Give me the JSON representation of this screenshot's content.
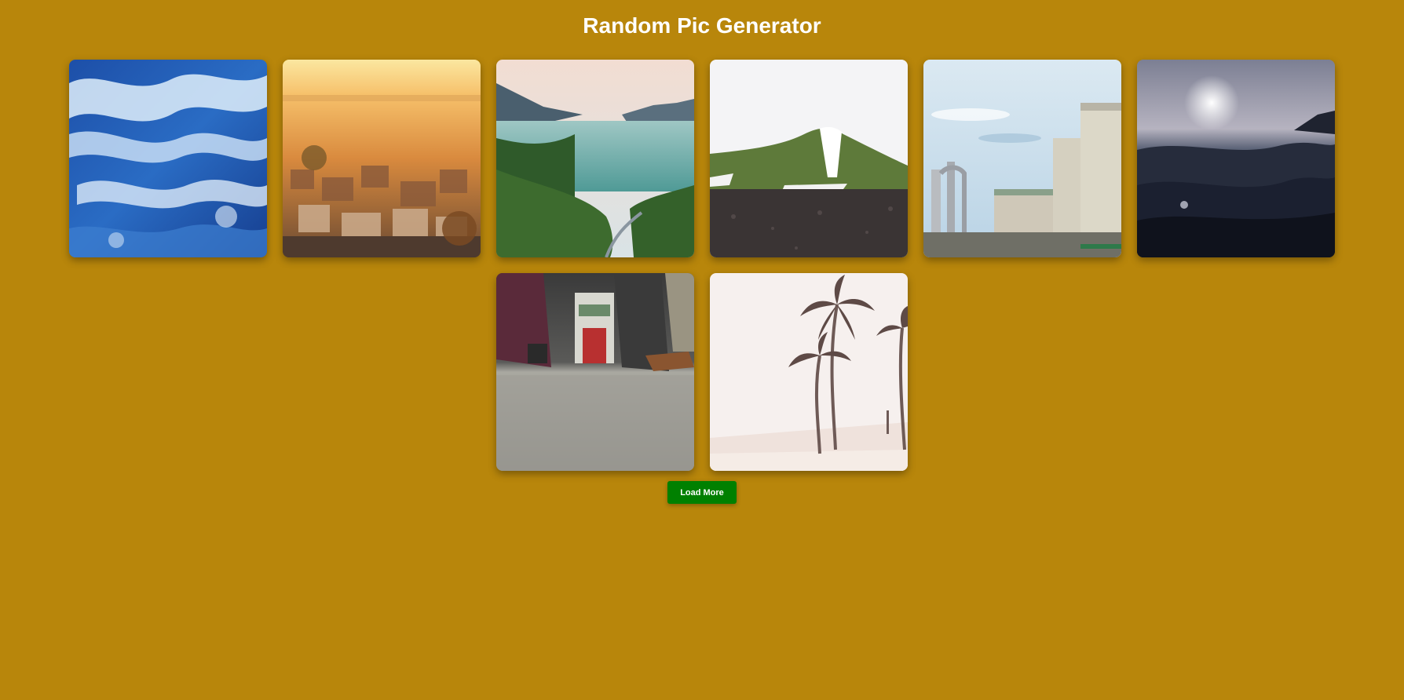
{
  "header": {
    "title": "Random Pic Generator"
  },
  "gallery": {
    "images": [
      {
        "subject": "ocean waves"
      },
      {
        "subject": "city at sunset"
      },
      {
        "subject": "mountain lake"
      },
      {
        "subject": "snowy hill"
      },
      {
        "subject": "industrial tanks"
      },
      {
        "subject": "dark sea"
      },
      {
        "subject": "subway interior"
      },
      {
        "subject": "palm trees beach"
      }
    ]
  },
  "actions": {
    "load_more_label": "Load More"
  },
  "colors": {
    "background": "#b8860b",
    "button": "#008000",
    "title": "#ffffff"
  }
}
